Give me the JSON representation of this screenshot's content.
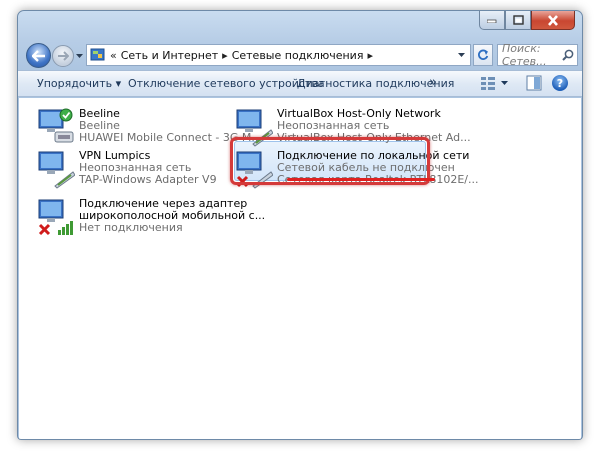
{
  "window": {
    "caption_buttons": [
      "minimize-icon",
      "maximize-icon",
      "close-icon"
    ]
  },
  "address_bar": {
    "overflow": "«",
    "crumbs": [
      "Сеть и Интернет",
      "Сетевые подключения"
    ],
    "separator": "▸"
  },
  "search": {
    "placeholder": "Поиск: Сетев..."
  },
  "toolbar": {
    "organize": "Упорядочить ▾",
    "disable_device": "Отключение сетевого устройства",
    "diagnose": "Диагностика подключения",
    "more": "»"
  },
  "connections": [
    {
      "name": "Beeline",
      "status": "Beeline",
      "device": "HUAWEI Mobile Connect - 3G M...",
      "state": "connected"
    },
    {
      "name": "VirtualBox Host-Only Network",
      "status": "Неопознанная сеть",
      "device": "VirtualBox Host-Only Ethernet Ad...",
      "state": "normal"
    },
    {
      "name": "VPN Lumpics",
      "status": "Неопознанная сеть",
      "device": "TAP-Windows Adapter V9",
      "state": "normal"
    },
    {
      "name": "Подключение по локальной сети",
      "status": "Сетевой кабель не подключен",
      "device": "Сетевая карта Realtek RTL8102E/...",
      "state": "disconnected",
      "selected": true
    },
    {
      "name": "Подключение через адаптер",
      "name_line2": "широкополосной мобильной с...",
      "status": "Нет подключения",
      "state": "disconnected"
    }
  ],
  "colors": {
    "highlight_border": "#d43a3a",
    "underline": "#e02020",
    "toolbar_text": "#1e395b"
  }
}
